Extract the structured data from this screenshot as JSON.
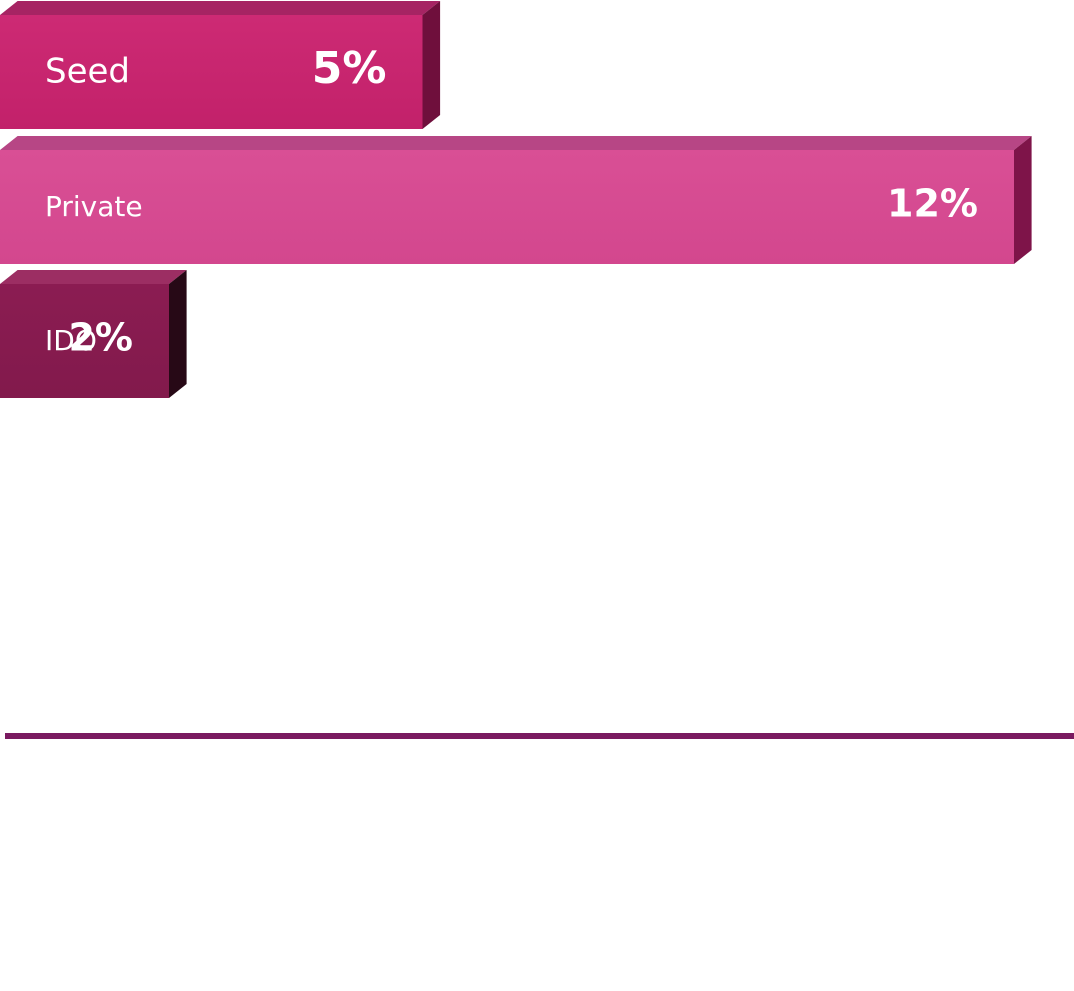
{
  "chart_data": {
    "type": "bar",
    "orientation": "horizontal",
    "style": "3d",
    "title": "",
    "xlabel": "",
    "ylabel": "",
    "xlim": [
      0,
      12
    ],
    "categories": [
      "Seed",
      "Private",
      "IDO"
    ],
    "values": [
      5,
      12,
      2
    ],
    "value_labels": [
      "5%",
      "12%",
      "2%"
    ],
    "unit": "%",
    "colors": [
      "#c8246e",
      "#d64a92",
      "#861a4e"
    ],
    "grid": false,
    "legend": "none"
  },
  "divider": {
    "color": "#7a1a60"
  }
}
